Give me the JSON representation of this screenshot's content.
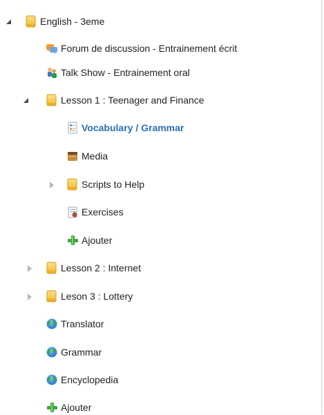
{
  "tree": {
    "root": {
      "label": "English - 3eme",
      "expanded": true,
      "icon": "folder-icon"
    },
    "forum": {
      "label": "Forum de discussion - Entrainement écrit",
      "icon": "forum-icon"
    },
    "talk_show": {
      "label": "Talk Show - Entrainement oral",
      "icon": "talk-show-icon"
    },
    "lesson1": {
      "label": "Lesson 1 : Teenager and Finance",
      "expanded": true,
      "icon": "folder-icon",
      "children": {
        "vocabulary": {
          "label": "Vocabulary / Grammar",
          "icon": "document-icon",
          "selected": true
        },
        "media": {
          "label": "Media",
          "icon": "media-icon"
        },
        "scripts": {
          "label": "Scripts to Help",
          "expanded": false,
          "icon": "folder-icon"
        },
        "exercises": {
          "label": "Exercises",
          "icon": "exercises-icon"
        },
        "add": {
          "label": "Ajouter",
          "icon": "add-icon"
        }
      }
    },
    "lesson2": {
      "label": "Lesson 2 : Internet",
      "expanded": false,
      "icon": "folder-icon"
    },
    "lesson3": {
      "label": "Leson 3 : Lottery",
      "expanded": false,
      "icon": "folder-icon"
    },
    "translator": {
      "label": "Translator",
      "icon": "globe-icon"
    },
    "grammar": {
      "label": "Grammar",
      "icon": "globe-icon"
    },
    "encyclopedia": {
      "label": "Encyclopedia",
      "icon": "globe-icon"
    },
    "add_root": {
      "label": "Ajouter",
      "icon": "add-icon"
    }
  },
  "colors": {
    "selected_text": "#2b6fb6",
    "folder": "#f2c63b",
    "text": "#222222"
  }
}
